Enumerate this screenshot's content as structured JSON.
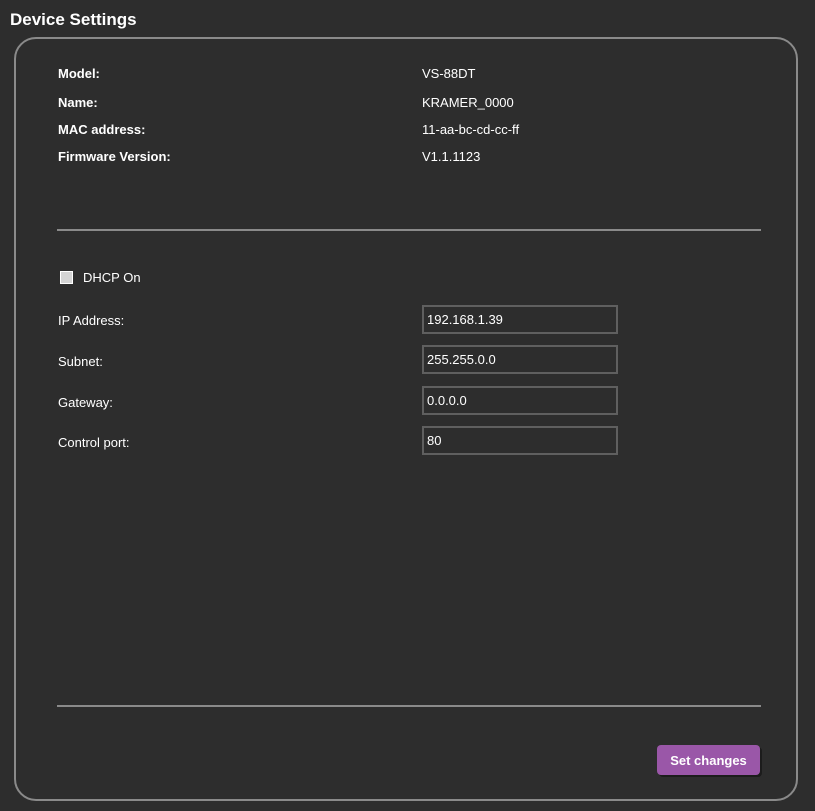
{
  "title": "Device Settings",
  "device_info": [
    {
      "label": "Model:",
      "value": "VS-88DT"
    },
    {
      "label": "Name:",
      "value": "KRAMER_0000"
    },
    {
      "label": "MAC address:",
      "value": "11-aa-bc-cd-cc-ff"
    },
    {
      "label": "Firmware Version:",
      "value": "V1.1.1123"
    }
  ],
  "dhcp": {
    "label": "DHCP On",
    "checked": false
  },
  "network": [
    {
      "label": "IP Address:",
      "value": "192.168.1.39"
    },
    {
      "label": "Subnet:",
      "value": "255.255.0.0"
    },
    {
      "label": "Gateway:",
      "value": "0.0.0.0"
    },
    {
      "label": "Control port:",
      "value": "80"
    }
  ],
  "actions": {
    "set_label": "Set changes"
  },
  "colors": {
    "background": "#2d2d2d",
    "border": "#8a8a8a",
    "button": "#9a57a8"
  }
}
